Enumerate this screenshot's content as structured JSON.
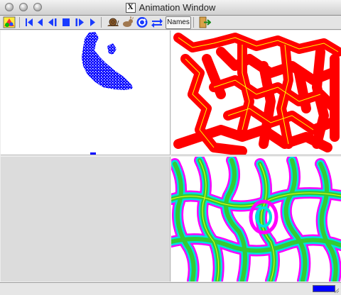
{
  "window": {
    "title": "Animation Window"
  },
  "toolbar": {
    "names_label": "Names",
    "icons": [
      "palette-icon",
      "first-frame-icon",
      "step-back-icon",
      "play-backward-icon",
      "stop-icon",
      "play-forward-icon",
      "step-forward-icon",
      "slow-snail-icon",
      "fast-rabbit-icon",
      "loop-icon",
      "swap-icon",
      "exit-icon"
    ]
  },
  "panels": [
    {
      "name": "top-left",
      "content": "blue point cloud"
    },
    {
      "name": "top-right",
      "content": "red network map"
    },
    {
      "name": "bottom-left",
      "content": "empty"
    },
    {
      "name": "bottom-right",
      "content": "contour stream map"
    }
  ],
  "status": {
    "progress": 1.0,
    "progress_color": "#0000ff"
  },
  "colors": {
    "blue": "#0000ff",
    "red": "#ff0000",
    "yellow": "#ffff00",
    "magenta": "#ff00ff",
    "green": "#33cc33",
    "cyan": "#00e0e0"
  }
}
